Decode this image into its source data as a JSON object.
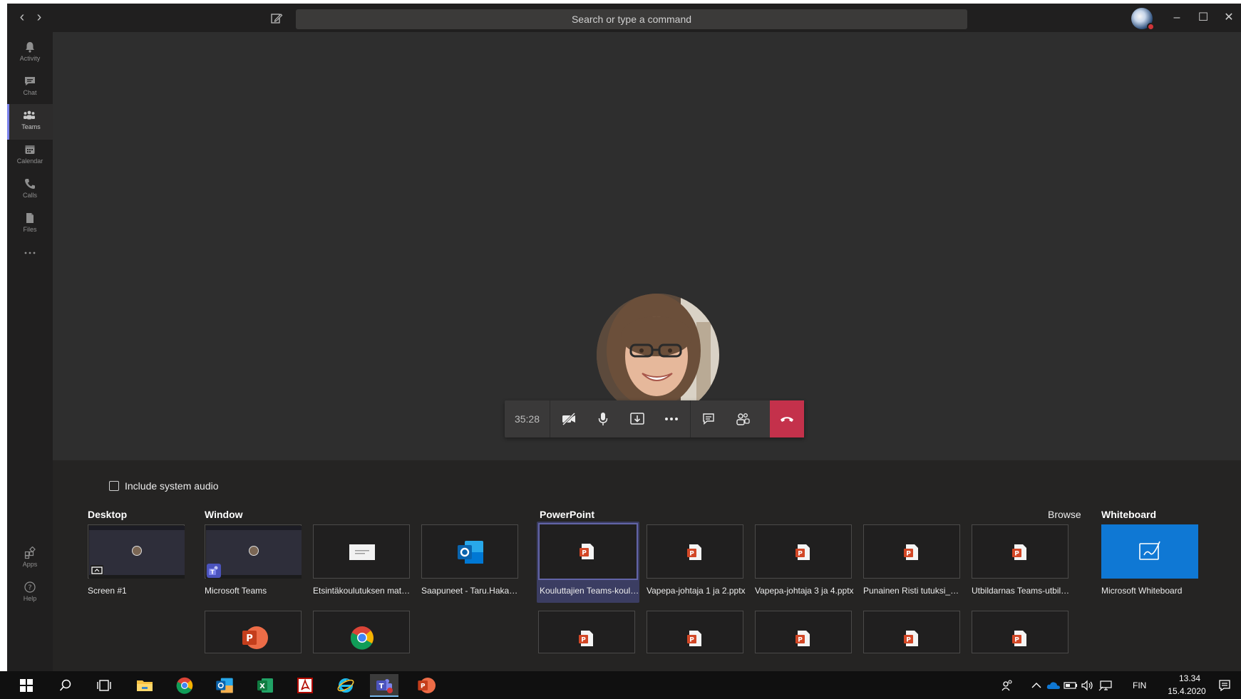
{
  "titlebar": {
    "search_placeholder": "Search or type a command",
    "back_icon": "chevron-left-icon",
    "forward_icon": "chevron-right-icon",
    "compose_icon": "compose-icon",
    "minimize": "–",
    "maximize": "☐",
    "close": "✕"
  },
  "rail": {
    "items": [
      {
        "label": "Activity",
        "icon": "bell-icon"
      },
      {
        "label": "Chat",
        "icon": "chat-icon"
      },
      {
        "label": "Teams",
        "icon": "teams-icon",
        "active": true
      },
      {
        "label": "Calendar",
        "icon": "calendar-icon"
      },
      {
        "label": "Calls",
        "icon": "phone-icon"
      },
      {
        "label": "Files",
        "icon": "file-icon"
      },
      {
        "label": "",
        "icon": "more-icon"
      }
    ],
    "apps_label": "Apps",
    "help_label": "Help"
  },
  "call": {
    "timer": "35:28",
    "controls": [
      "camera-off-icon",
      "microphone-icon",
      "share-tray-icon",
      "more-icon",
      "chat-icon",
      "participants-icon",
      "hang-up-icon"
    ]
  },
  "tray": {
    "include_audio_label": "Include system audio",
    "sections": {
      "desktop": "Desktop",
      "window": "Window",
      "powerpoint": "PowerPoint",
      "browse": "Browse",
      "whiteboard": "Whiteboard"
    },
    "desktop_tiles": [
      {
        "label": "Screen #1"
      }
    ],
    "window_tiles": [
      {
        "label": "Microsoft Teams"
      },
      {
        "label": "Etsintäkoulutuksen mater..."
      },
      {
        "label": "Saapuneet - Taru.Hakane..."
      }
    ],
    "powerpoint_tiles": [
      {
        "label": "Kouluttajien Teams-koulu...",
        "selected": true
      },
      {
        "label": "Vapepa-johtaja 1 ja 2.pptx"
      },
      {
        "label": "Vapepa-johtaja 3 ja 4.pptx"
      },
      {
        "label": "Punainen Risti tutuksi_ko..."
      },
      {
        "label": "Utbildarnas Teams-utbild..."
      }
    ],
    "whiteboard_tiles": [
      {
        "label": "Microsoft Whiteboard"
      }
    ]
  },
  "taskbar": {
    "language": "FIN",
    "time": "13.34",
    "date": "15.4.2020"
  },
  "colors": {
    "accent": "#6264a7",
    "hangup": "#c4314b",
    "whiteboard": "#0f78d4",
    "powerpoint": "#d24726"
  }
}
